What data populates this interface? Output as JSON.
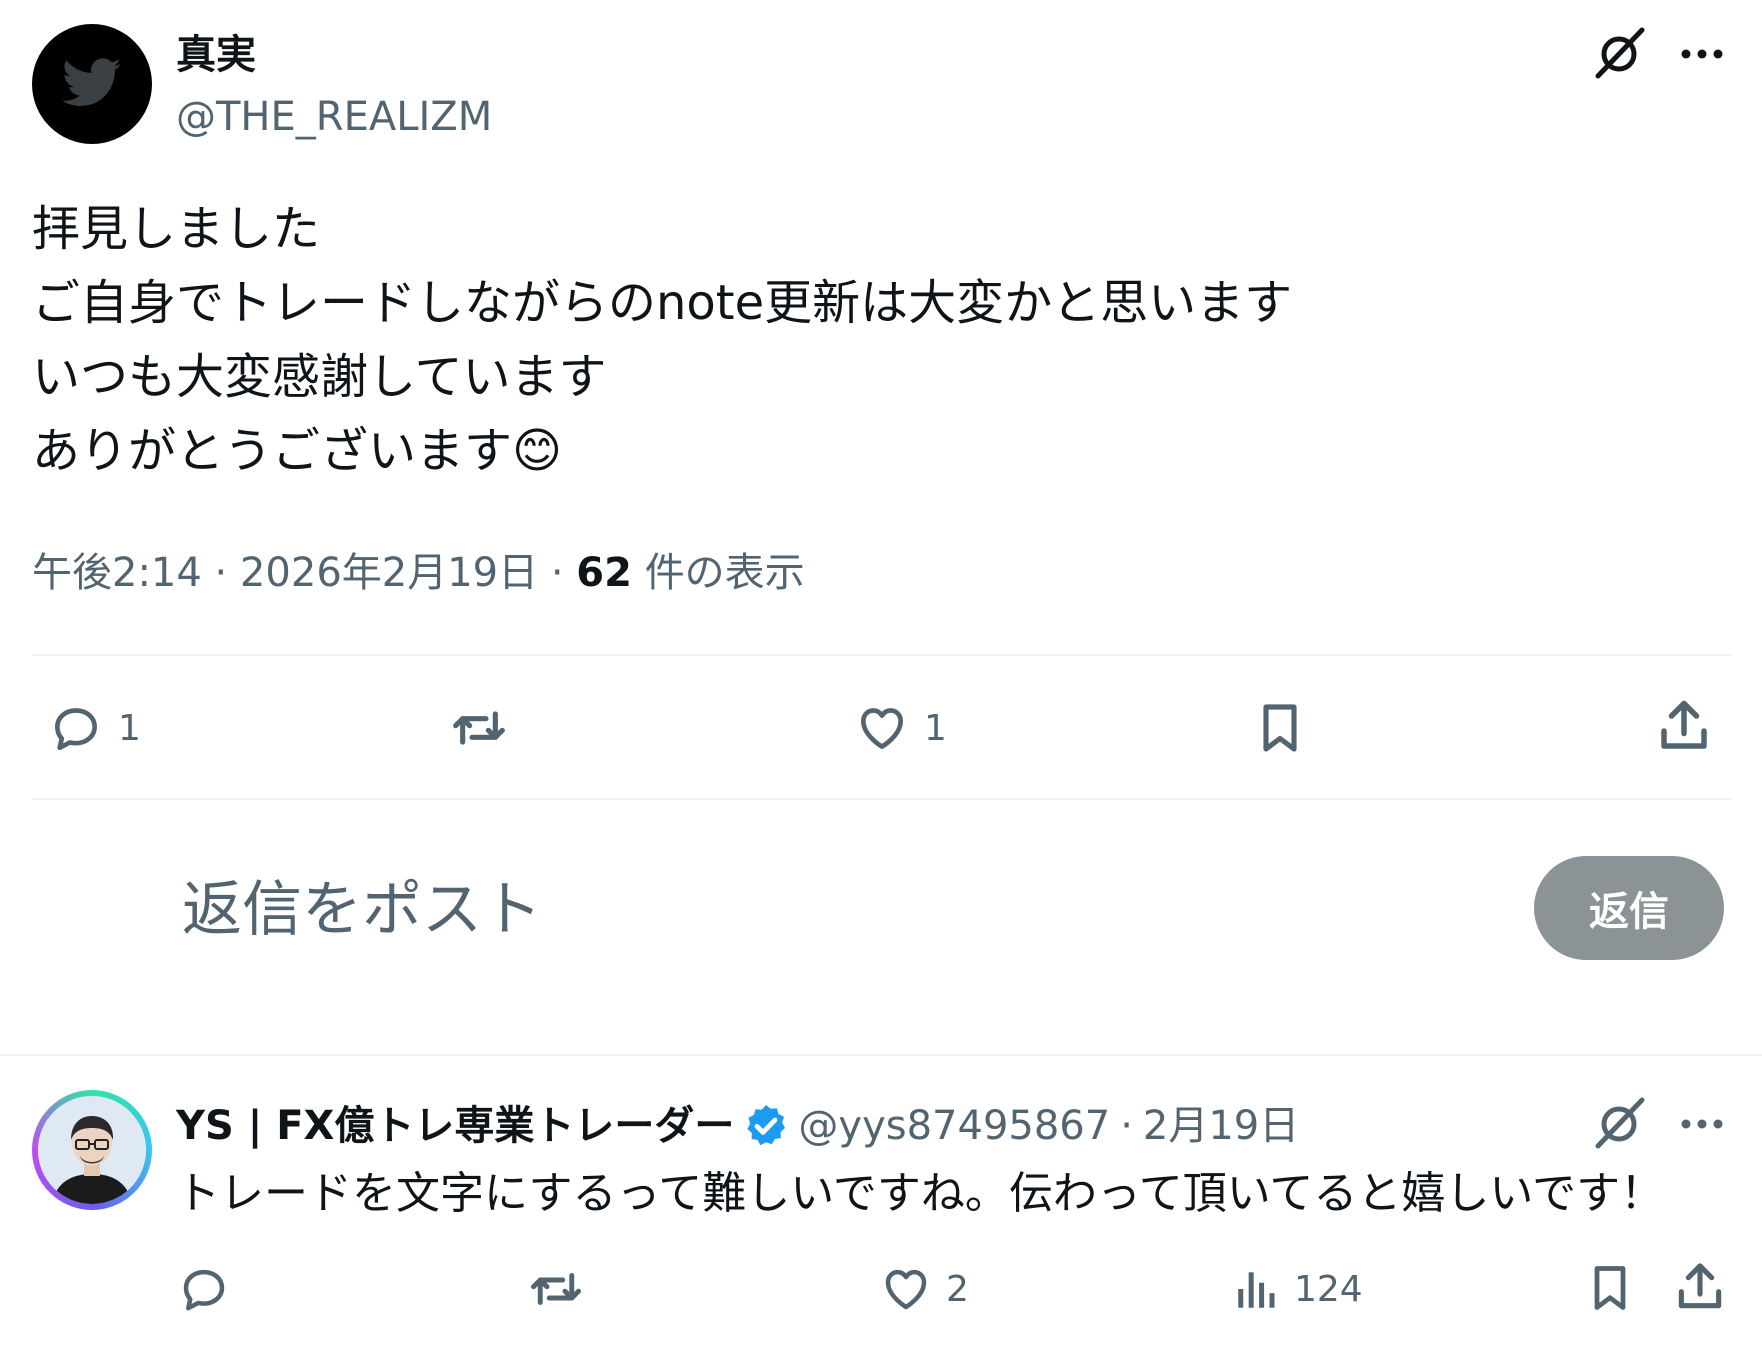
{
  "tweet": {
    "author_name": "真実",
    "author_handle": "@THE_REALIZM",
    "body_lines": [
      "拝見しました",
      "ご自身でトレードしながらのnote更新は大変かと思います",
      "いつも大変感謝しています",
      "ありがとうございます"
    ],
    "emoji": "😊",
    "time": "午後2:14",
    "date": "2026年2月19日",
    "views_count": "62",
    "views_label": "件の表示",
    "separator": "·",
    "reply_count": "1",
    "like_count": "1"
  },
  "composer": {
    "placeholder": "返信をポスト",
    "reply_button": "返信"
  },
  "reply": {
    "author_name": "YS | FX億トレ専業トレーダー",
    "author_handle": "@yys87495867",
    "separator": "·",
    "date": "2月19日",
    "verified": true,
    "body": "トレードを文字にするって難しいですね。伝わって頂いてると嬉しいです！",
    "like_count": "2",
    "view_count": "124"
  },
  "icons": {
    "avatar1": "bird-logo-icon",
    "grok": "grok-icon",
    "more": "more-dots-icon",
    "reply": "reply-icon",
    "repost": "repost-icon",
    "like": "heart-icon",
    "bookmark": "bookmark-icon",
    "share": "share-icon",
    "views": "views-chart-icon",
    "verified": "verified-badge-icon"
  },
  "colors": {
    "text": "#0f1419",
    "muted": "#536471",
    "verified": "#1d9bf0",
    "reply_button_bg": "#8c9396",
    "divider": "#eff3f4"
  }
}
